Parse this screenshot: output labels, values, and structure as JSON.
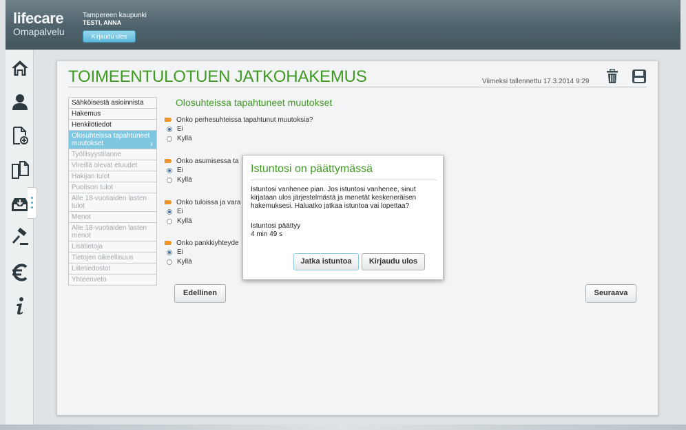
{
  "header": {
    "logo_main": "lifecare",
    "logo_sub": "Omapalvelu",
    "city": "Tampereen kaupunki",
    "user_name": "TESTI, ANNA",
    "logout_label": "Kirjaudu ulos"
  },
  "sidebar": {
    "icons": [
      "home-icon",
      "person-icon",
      "new-document-icon",
      "documents-icon",
      "inbox-icon",
      "gavel-icon",
      "euro-icon",
      "info-icon"
    ]
  },
  "page": {
    "title": "TOIMEENTULOTUEN JATKOHAKEMUS",
    "saved_label": "Viimeksi tallennettu 17.3.2014 9:29"
  },
  "steps": [
    {
      "label": "Sähköisestä asioinnista",
      "state": "done"
    },
    {
      "label": "Hakemus",
      "state": "done"
    },
    {
      "label": "Henkilötiedot",
      "state": "done"
    },
    {
      "label": "Olosuhteissa tapahtuneet muutokset",
      "state": "active"
    },
    {
      "label": "Työllisyystilanne",
      "state": "disabled"
    },
    {
      "label": "Vireillä olevat etuudet",
      "state": "disabled"
    },
    {
      "label": "Hakijan tulot",
      "state": "disabled"
    },
    {
      "label": "Puolison tulot",
      "state": "disabled"
    },
    {
      "label": "Alle 18-vuotiaiden lasten tulot",
      "state": "disabled"
    },
    {
      "label": "Menot",
      "state": "disabled"
    },
    {
      "label": "Alle 18-vuotiaiden lasten menot",
      "state": "disabled"
    },
    {
      "label": "Lisätietoja",
      "state": "disabled"
    },
    {
      "label": "Tietojen oikeellisuus",
      "state": "disabled"
    },
    {
      "label": "Liitetiedostot",
      "state": "disabled"
    },
    {
      "label": "Yhteenveto",
      "state": "disabled"
    }
  ],
  "section": {
    "title": "Olosuhteissa tapahtuneet muutokset",
    "questions": [
      {
        "text": "Onko perhesuhteissa tapahtunut muutoksia?",
        "options": [
          "Ei",
          "Kyllä"
        ],
        "selected": 0
      },
      {
        "text": "Onko asumisessa ta",
        "options": [
          "Ei",
          "Kyllä"
        ],
        "selected": 0
      },
      {
        "text": "Onko tuloissa ja vara",
        "options": [
          "Ei",
          "Kyllä"
        ],
        "selected": 0
      },
      {
        "text": "Onko pankkiyhteyde",
        "options": [
          "Ei",
          "Kyllä"
        ],
        "selected": 0
      }
    ],
    "prev_label": "Edellinen",
    "next_label": "Seuraava"
  },
  "modal": {
    "title": "Istuntosi on päättymässä",
    "text": "Istuntosi vanhenee pian. Jos istuntosi vanhenee, sinut kirjataan ulos järjestelmästä ja menetät keskeneräisen hakemuksesi. Haluatko jatkaa istuntoa vai lopettaa?",
    "status_label": "Istuntosi päättyy",
    "time_left": "4 min 49 s",
    "continue_label": "Jatka istuntoa",
    "logout_label": "Kirjaudu ulos"
  },
  "colors": {
    "accent_green": "#3f9a22",
    "active_step": "#7fc7e0",
    "arrow_orange": "#f0932b"
  }
}
